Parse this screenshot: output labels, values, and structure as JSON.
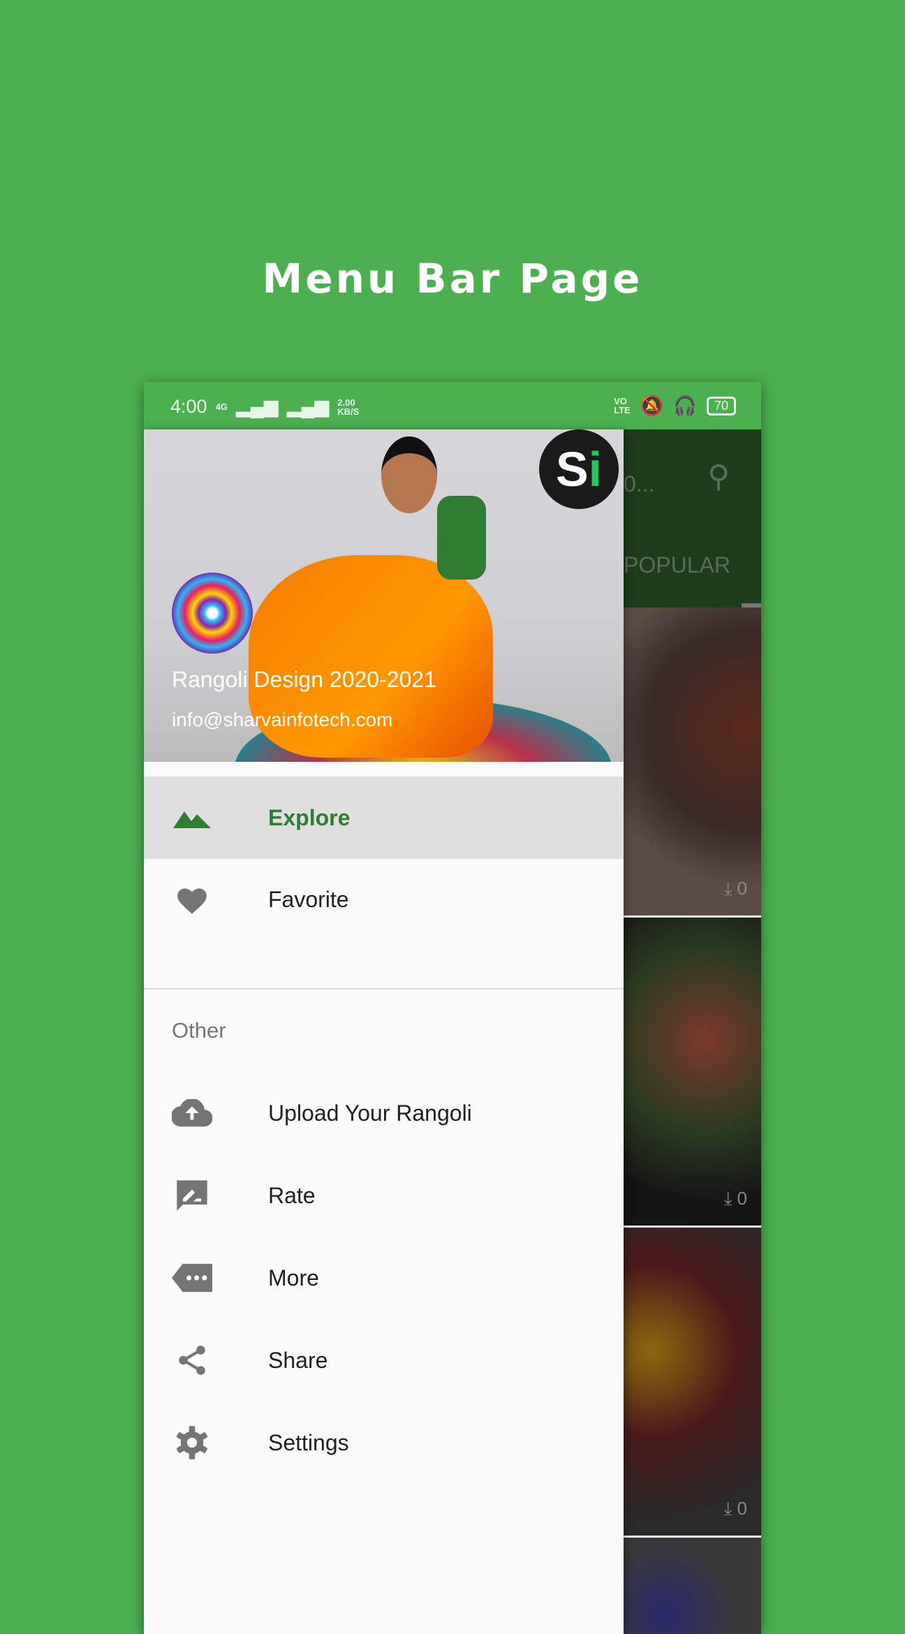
{
  "page_title": "Menu Bar Page",
  "status_bar": {
    "time": "4:00",
    "network": "4G",
    "speed_value": "2.00",
    "speed_unit": "KB/S",
    "volte_top": "VO",
    "volte_bottom": "LTE",
    "battery": "70"
  },
  "app_behind": {
    "title_fragment": "0...",
    "tab_label": "POPULAR",
    "tiles": [
      {
        "download_count": "0"
      },
      {
        "download_count": "0"
      },
      {
        "download_count": "0"
      },
      {
        "download_count": ""
      }
    ]
  },
  "drawer": {
    "header": {
      "app_name": "Rangoli Design 2020-2021",
      "email": "info@sharvainfotech.com",
      "logo_text": "Si"
    },
    "primary_items": [
      {
        "label": "Explore",
        "icon": "landscape-icon",
        "active": true
      },
      {
        "label": "Favorite",
        "icon": "heart-icon",
        "active": false
      }
    ],
    "section_label": "Other",
    "other_items": [
      {
        "label": "Upload Your Rangoli",
        "icon": "cloud-upload-icon"
      },
      {
        "label": "Rate",
        "icon": "rate-review-icon"
      },
      {
        "label": "More",
        "icon": "more-tag-icon"
      },
      {
        "label": "Share",
        "icon": "share-icon"
      },
      {
        "label": "Settings",
        "icon": "settings-icon"
      }
    ]
  },
  "colors": {
    "background": "#4caf50",
    "toolbar": "#1d3d1b",
    "accent": "#2e7d32"
  }
}
